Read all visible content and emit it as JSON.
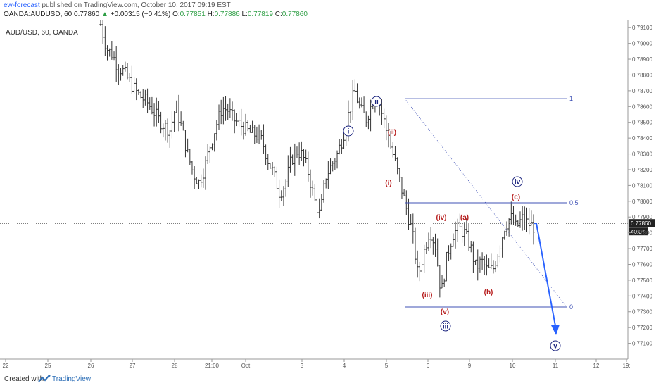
{
  "header": {
    "author": "ew-forecast",
    "published": "published on TradingView.com, October 10, 2017 09:19 EST",
    "symbol": "OANDA:AUDUSD, 60",
    "last": "0.77860",
    "change_arrow": "▲",
    "change": "+0.00315 (+0.41%)",
    "o_label": "O:",
    "o_value": "0.77851",
    "h_label": "H:",
    "h_value": "0.77886",
    "l_label": "L:",
    "l_value": "0.77819",
    "c_label": "C:",
    "c_value": "0.77860"
  },
  "chart_label": "AUD/USD, 60, OANDA",
  "footer": {
    "created_with": "Created with",
    "brand": "TradingView"
  },
  "colors": {
    "bars": "#333333",
    "wave_blue": "#1a237e",
    "wave_red": "#b71c1c",
    "fib": "#3f51b5",
    "arrow": "#2962ff"
  },
  "chart_data": {
    "type": "candlestick",
    "symbol": "AUD/USD",
    "timeframe": "60",
    "ylim": [
      0.77,
      0.7915
    ],
    "y_ticks": [
      "0.79100",
      "0.79000",
      "0.78900",
      "0.78800",
      "0.78700",
      "0.78600",
      "0.78500",
      "0.78400",
      "0.78300",
      "0.78200",
      "0.78100",
      "0.78000",
      "0.77900",
      "0.77800",
      "0.77700",
      "0.77600",
      "0.77500",
      "0.77400",
      "0.77300",
      "0.77200",
      "0.77100"
    ],
    "x_ticks": [
      "22",
      "25",
      "26",
      "27",
      "28",
      "21:00",
      "Oct",
      "3",
      "4",
      "5",
      "6",
      "9",
      "10",
      "11",
      "12",
      "19:"
    ],
    "price_line": 0.7786,
    "price_label": "0.77860",
    "countdown": "40:07",
    "price_path": [
      0.7912,
      0.7897,
      0.7893,
      0.7885,
      0.7882,
      0.7876,
      0.787,
      0.7866,
      0.7863,
      0.7858,
      0.7852,
      0.7848,
      0.7845,
      0.786,
      0.7847,
      0.7831,
      0.7818,
      0.7812,
      0.7821,
      0.7836,
      0.7848,
      0.7859,
      0.7858,
      0.7852,
      0.7849,
      0.7846,
      0.7843,
      0.7842,
      0.7838,
      0.7826,
      0.7817,
      0.7805,
      0.7811,
      0.7826,
      0.7832,
      0.7829,
      0.7818,
      0.7801,
      0.7791,
      0.7816,
      0.7823,
      0.783,
      0.7841,
      0.7856,
      0.787,
      0.7858,
      0.7852,
      0.7862,
      0.7866,
      0.7852,
      0.7838,
      0.7825,
      0.781,
      0.7795,
      0.778,
      0.7752,
      0.7768,
      0.7782,
      0.7772,
      0.7741,
      0.7765,
      0.7779,
      0.7783,
      0.778,
      0.7772,
      0.7758,
      0.7762,
      0.7756,
      0.7757,
      0.777,
      0.7784,
      0.779,
      0.7783,
      0.7789,
      0.7786,
      0.7784
    ],
    "fib_levels": [
      {
        "label": "1",
        "price": 0.7865
      },
      {
        "label": "0.5",
        "price": 0.7799
      },
      {
        "label": "0",
        "price": 0.7733
      }
    ],
    "wave_labels": {
      "blue_i": "i",
      "blue_ii": "ii",
      "blue_iii": "iii",
      "blue_iv": "iv",
      "blue_v": "v",
      "red_i": "(i)",
      "red_ii": "(ii)",
      "red_iii": "(iii)",
      "red_iv": "(iv)",
      "red_v": "(v)",
      "red_a": "(a)",
      "red_b": "(b)",
      "red_c": "(c)"
    }
  }
}
